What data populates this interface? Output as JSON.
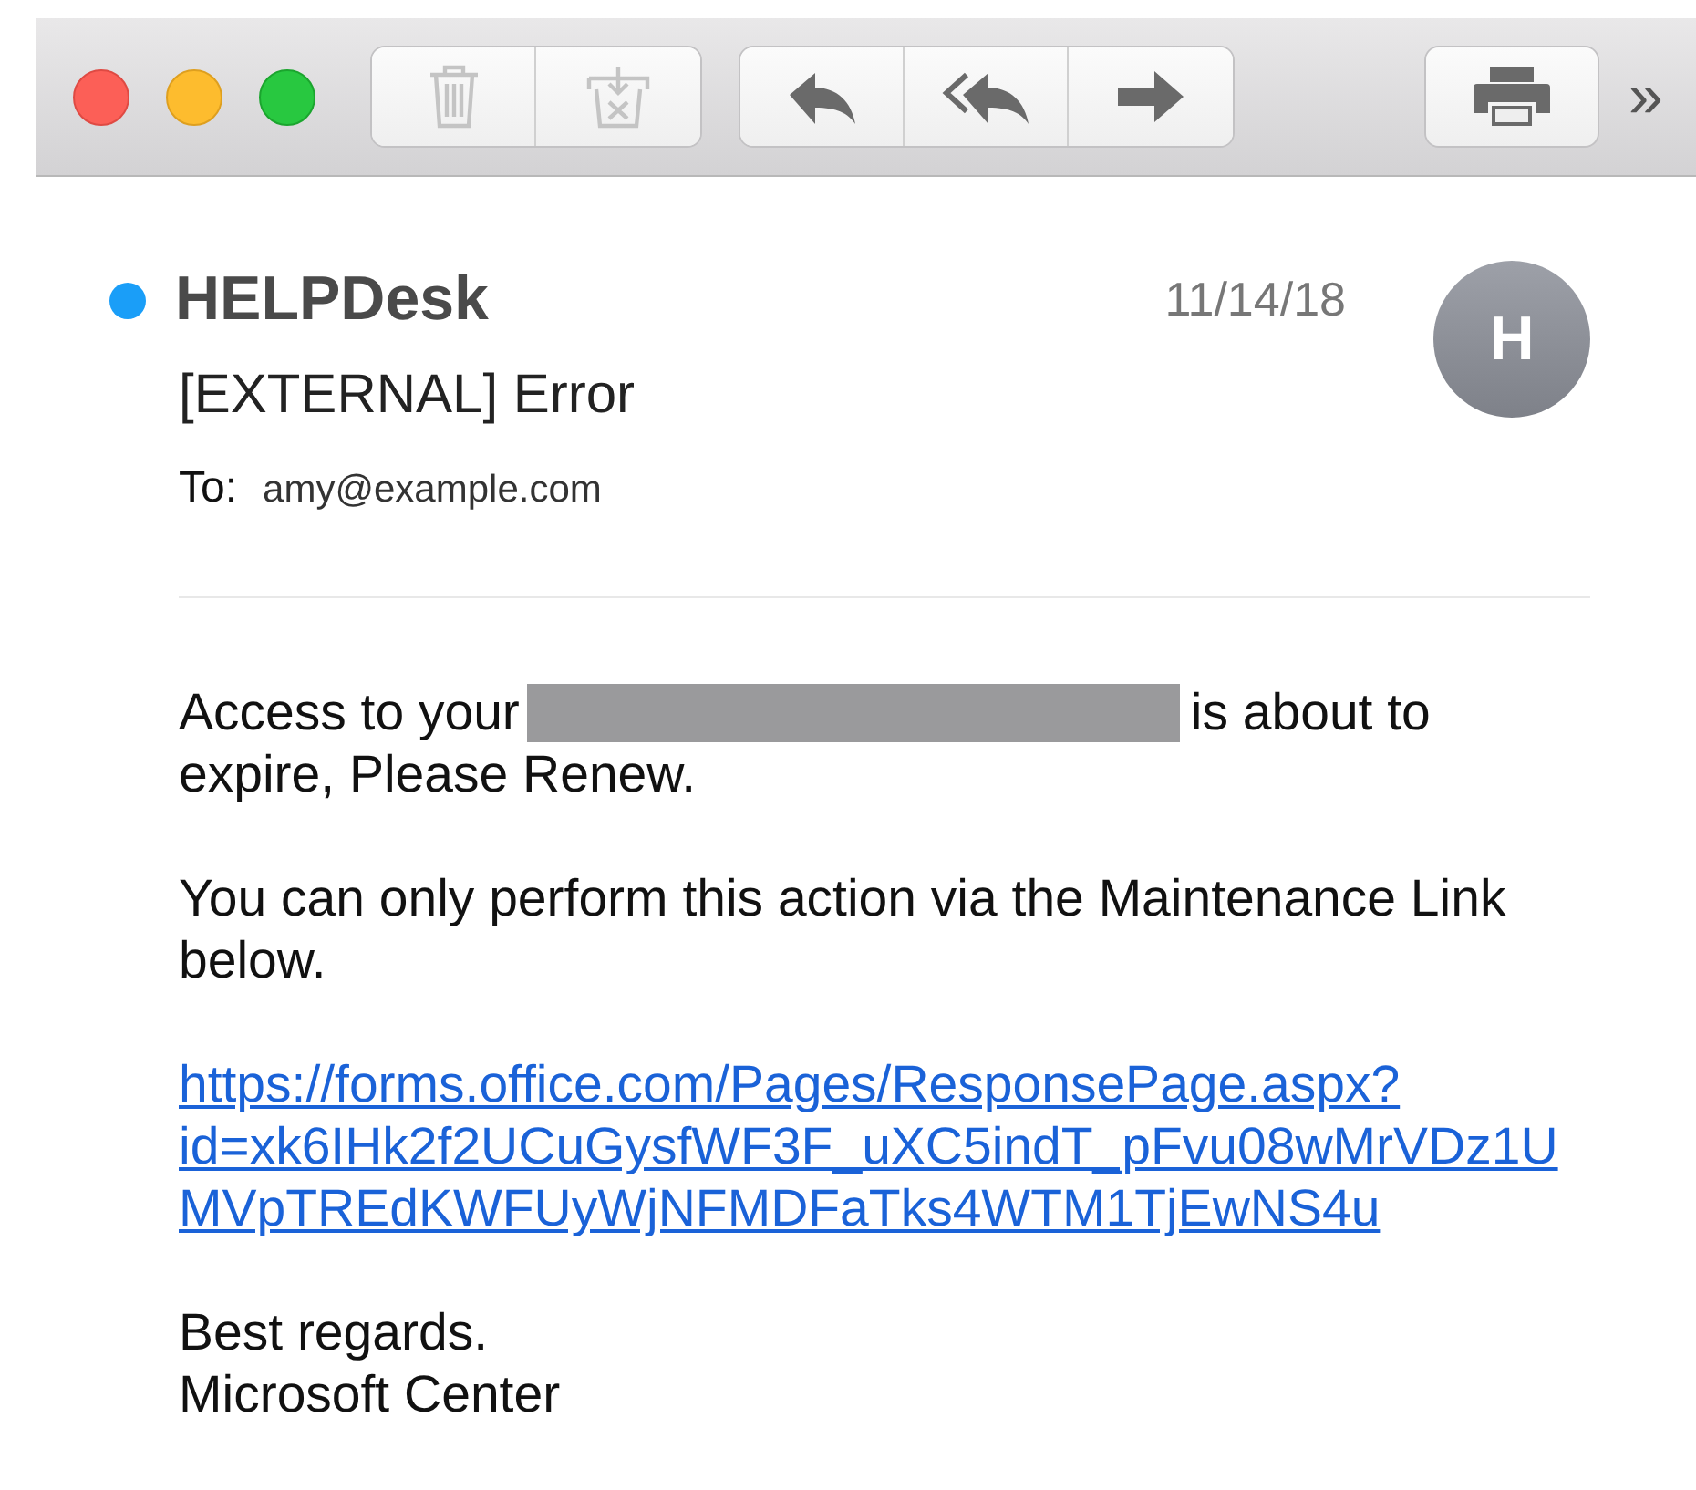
{
  "toolbar": {
    "groups": [
      {
        "buttons": [
          {
            "kind": "trash",
            "disabled": true
          },
          {
            "kind": "junk",
            "disabled": true
          }
        ]
      },
      {
        "buttons": [
          {
            "kind": "reply",
            "disabled": false
          },
          {
            "kind": "reply-all",
            "disabled": false
          },
          {
            "kind": "forward",
            "disabled": false
          }
        ]
      },
      {
        "buttons": [
          {
            "kind": "print",
            "disabled": false
          }
        ]
      }
    ],
    "overflow": "»"
  },
  "message": {
    "unread": true,
    "sender": "HELPDesk",
    "date": "11/14/18",
    "avatar": "H",
    "subject": "[EXTERNAL] Error",
    "to_label": "To:",
    "to": "amy@example.com",
    "body": {
      "intro_before": "Access to your",
      "intro_after": "is about to",
      "intro_rest": "expire, Please Renew.",
      "paragraph": "You can only perform this action via the Maintenance Link below.",
      "link_lines": [
        "https://forms.office.com/Pages/ResponsePage.aspx?",
        "id=xk6IHk2f2UCuGysfWF3F_uXC5indT_pFvu08wMrVDz1U",
        "MVpTREdKWFUyWjNFMDFaTks4WTM1TjEwNS4u"
      ],
      "signoff": [
        "Best regards.",
        "Microsoft Center"
      ]
    }
  }
}
